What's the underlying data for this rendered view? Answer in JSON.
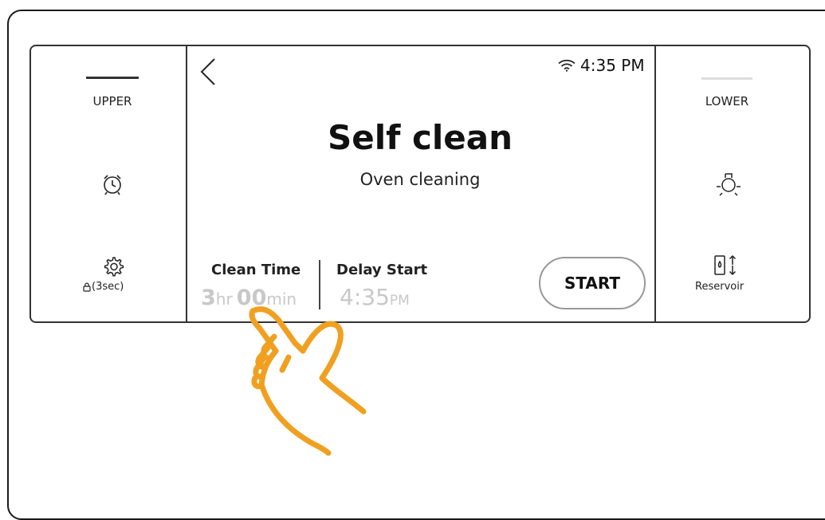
{
  "left_panel": {
    "tab_label": "UPPER",
    "timer_icon": "alarm-clock-icon",
    "settings_icon": "gear-icon",
    "lock_hint": "(3sec)"
  },
  "right_panel": {
    "tab_label": "LOWER",
    "light_icon": "light-bulb-icon",
    "reservoir_icon": "reservoir-icon",
    "reservoir_label": "Reservoir"
  },
  "status_bar": {
    "wifi_icon": "wifi-icon",
    "time": "4:35 PM"
  },
  "main": {
    "title": "Self clean",
    "subtitle": "Oven cleaning",
    "clean_time": {
      "label": "Clean Time",
      "hours": "3",
      "hours_unit": "hr",
      "minutes": "00",
      "minutes_unit": "min"
    },
    "delay_start": {
      "label": "Delay Start",
      "time": "4:35",
      "ampm": "PM"
    },
    "start_label": "START"
  },
  "colors": {
    "accent_hand": "#f0a020",
    "dim_text": "#c8c8c8"
  }
}
